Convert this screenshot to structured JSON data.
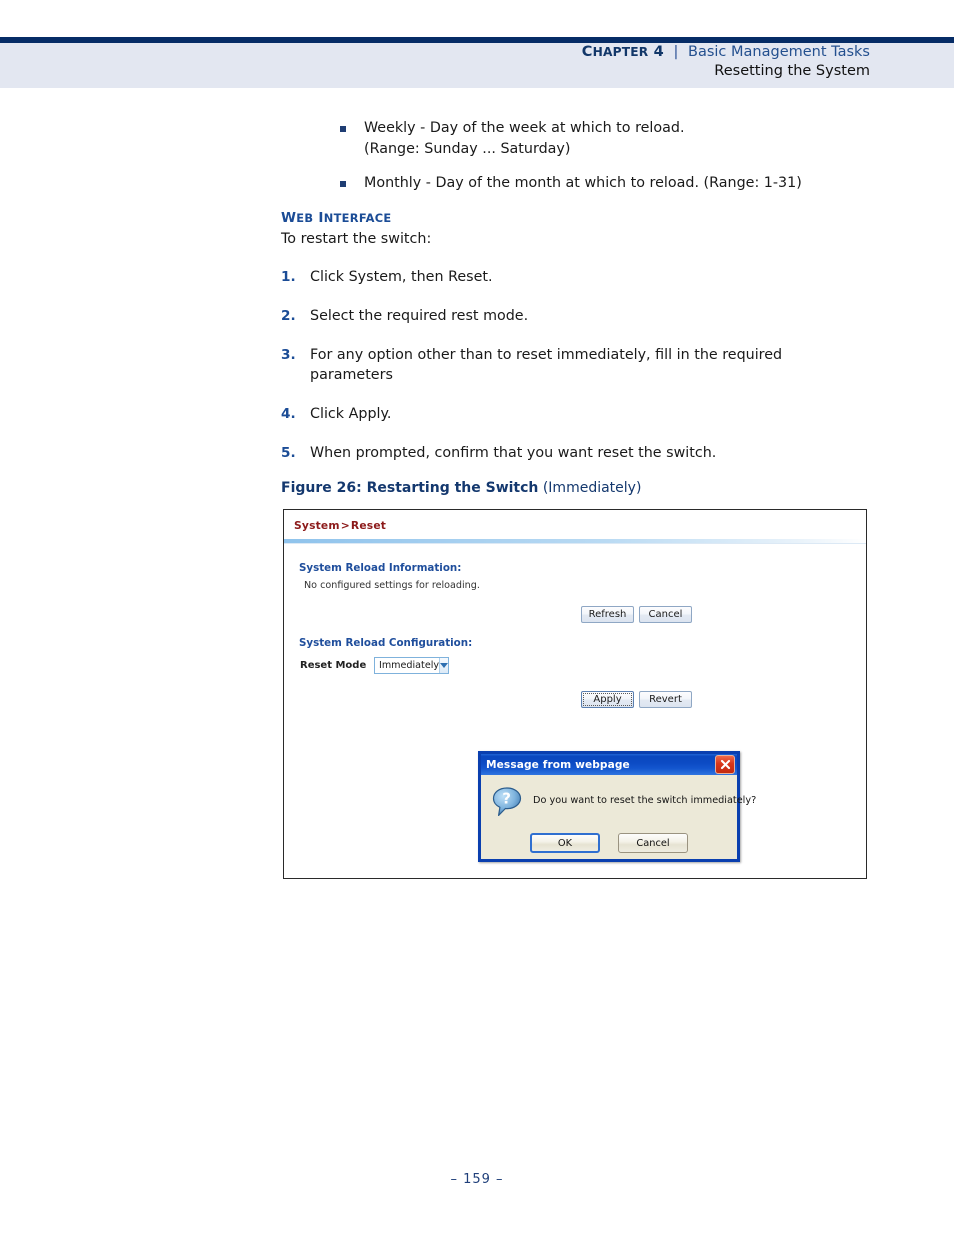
{
  "header": {
    "chapter_label": "Chapter 4",
    "chapter_first": "C",
    "chapter_rest": "HAPTER",
    "chapter_number": "4",
    "separator": "|",
    "book_title": "Basic Management Tasks",
    "section_title": "Resetting the System"
  },
  "bullets": [
    "Weekly - Day of the week at which to reload.\n(Range: Sunday ... Saturday)",
    "Monthly - Day of the month at which to reload. (Range: 1-31)"
  ],
  "web_interface": {
    "heading_first": "W",
    "heading_rest": "EB",
    "heading_second_first": "I",
    "heading_second_rest": "NTERFACE",
    "heading_full": "WEB INTERFACE",
    "lead": "To restart the switch:"
  },
  "steps": [
    {
      "num": "1.",
      "text": "Click System, then Reset."
    },
    {
      "num": "2.",
      "text": "Select the required rest mode."
    },
    {
      "num": "3.",
      "text": "For any option other than to reset immediately, fill in the required parameters"
    },
    {
      "num": "4.",
      "text": "Click Apply."
    },
    {
      "num": "5.",
      "text": " When prompted, confirm that you want reset the switch."
    }
  ],
  "figure": {
    "caption_bold": "Figure 26:  Restarting the Switch",
    "caption_regular": "(Immediately)",
    "screenshot": {
      "breadcrumb": "System > Reset",
      "breadcrumb_root": "System",
      "breadcrumb_arrow": ">",
      "breadcrumb_leaf": "Reset",
      "info_section_title": "System Reload Information:",
      "info_note": "No configured settings for reloading.",
      "refresh_button": "Refresh",
      "cancel_button": "Cancel",
      "config_section_title": "System Reload Configuration:",
      "reset_mode_label": "Reset Mode",
      "reset_mode_value": "Immediately",
      "apply_button": "Apply",
      "revert_button": "Revert"
    },
    "dialog": {
      "title": "Message from webpage",
      "icon": "question-icon",
      "message": "Do you want to reset the switch immediately?",
      "ok_button": "OK",
      "cancel_button": "Cancel",
      "close_button": "close-icon"
    }
  },
  "footer": {
    "page_number": "–  159  –"
  },
  "colors": {
    "header_rule": "#062C66",
    "header_band": "#E3E7F1",
    "heading_blue": "#1B4C96",
    "breadcrumb_red": "#8C1A1A",
    "panel_blue": "#1F4E9C",
    "dialog_border": "#0A3FAF",
    "dialog_body": "#ECE9D8"
  }
}
